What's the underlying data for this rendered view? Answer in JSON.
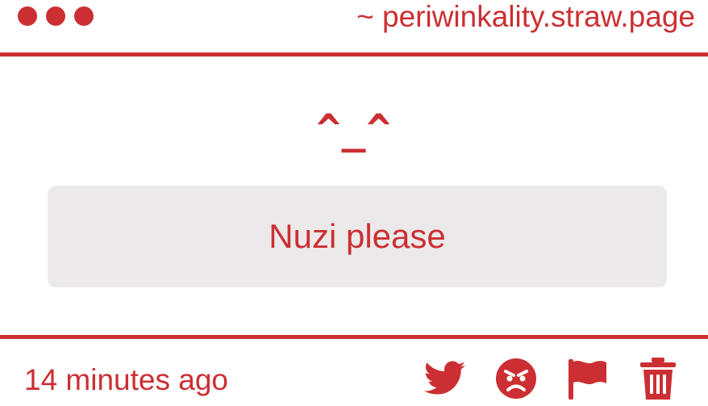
{
  "header": {
    "window_controls": [
      "dot",
      "dot",
      "dot"
    ],
    "site_label": "~ periwinkality.straw.page"
  },
  "main": {
    "face": "^_^",
    "message": "Nuzi please"
  },
  "footer": {
    "timestamp": "14 minutes ago",
    "actions": [
      {
        "icon": "twitter-icon"
      },
      {
        "icon": "angry-face-icon"
      },
      {
        "icon": "flag-icon"
      },
      {
        "icon": "trash-icon"
      }
    ]
  },
  "colors": {
    "accent": "#cc2f33",
    "message_bg": "#ebe9ea",
    "background": "#ffffff"
  }
}
